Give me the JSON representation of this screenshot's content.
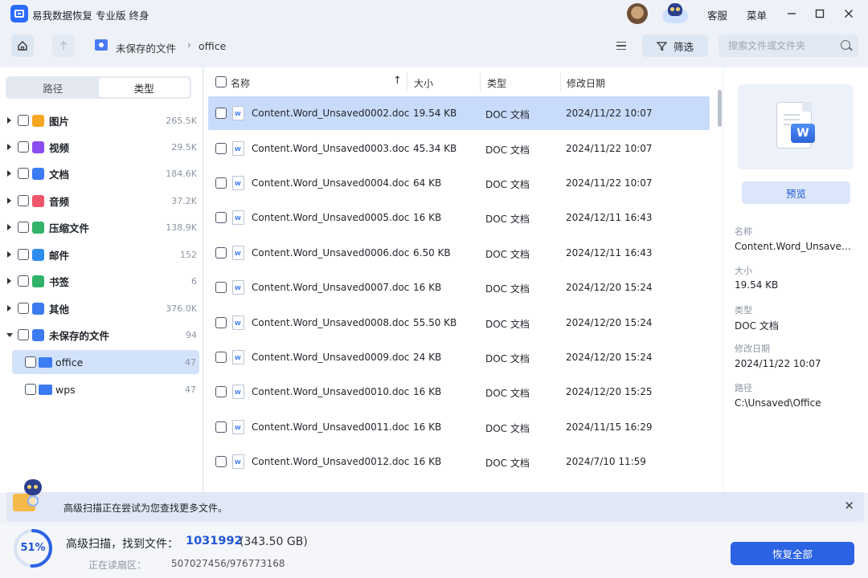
{
  "app": {
    "title": "易我数据恢复 专业版 终身",
    "service": "客服",
    "menu": "菜单"
  },
  "nav": {
    "crumbs": [
      "未保存的文件",
      "office"
    ],
    "crumb_sep": "›",
    "filter_label": "筛选",
    "search_placeholder": "搜索文件或文件夹"
  },
  "sidebar": {
    "tabs": [
      "路径",
      "类型"
    ],
    "active_tab": "类型",
    "categories": [
      {
        "label": "图片",
        "count": "265.5K",
        "icon": "image-icon",
        "color": "#f5a623"
      },
      {
        "label": "视频",
        "count": "29.5K",
        "icon": "video-icon",
        "color": "#8a4cf0"
      },
      {
        "label": "文档",
        "count": "184.6K",
        "icon": "document-icon",
        "color": "#3d7bf2"
      },
      {
        "label": "音频",
        "count": "37.2K",
        "icon": "audio-icon",
        "color": "#f0566a"
      },
      {
        "label": "压缩文件",
        "count": "138.9K",
        "icon": "archive-icon",
        "color": "#34b36b"
      },
      {
        "label": "邮件",
        "count": "152",
        "icon": "mail-icon",
        "color": "#2f8df0"
      },
      {
        "label": "书签",
        "count": "6",
        "icon": "bookmark-icon",
        "color": "#2fb36a"
      },
      {
        "label": "其他",
        "count": "376.0K",
        "icon": "other-icon",
        "color": "#3d7bf2"
      },
      {
        "label": "未保存的文件",
        "count": "94",
        "icon": "unsaved-folder-icon",
        "color": "#3d7bf2"
      }
    ],
    "children": [
      {
        "label": "office",
        "count": "47"
      },
      {
        "label": "wps",
        "count": "47"
      }
    ]
  },
  "table": {
    "headers": {
      "name": "名称",
      "size": "大小",
      "type": "类型",
      "modified": "修改日期"
    },
    "rows": [
      {
        "name": "Content.Word_Unsaved0002.doc",
        "size": "19.54 KB",
        "type": "DOC 文档",
        "modified": "2024/11/22 10:07"
      },
      {
        "name": "Content.Word_Unsaved0003.doc",
        "size": "45.34 KB",
        "type": "DOC 文档",
        "modified": "2024/11/22 10:07"
      },
      {
        "name": "Content.Word_Unsaved0004.doc",
        "size": "64 KB",
        "type": "DOC 文档",
        "modified": "2024/11/22 10:07"
      },
      {
        "name": "Content.Word_Unsaved0005.doc",
        "size": "16 KB",
        "type": "DOC 文档",
        "modified": "2024/12/11 16:43"
      },
      {
        "name": "Content.Word_Unsaved0006.doc",
        "size": "6.50 KB",
        "type": "DOC 文档",
        "modified": "2024/12/11 16:43"
      },
      {
        "name": "Content.Word_Unsaved0007.doc",
        "size": "16 KB",
        "type": "DOC 文档",
        "modified": "2024/12/20 15:24"
      },
      {
        "name": "Content.Word_Unsaved0008.doc",
        "size": "55.50 KB",
        "type": "DOC 文档",
        "modified": "2024/12/20 15:24"
      },
      {
        "name": "Content.Word_Unsaved0009.doc",
        "size": "24 KB",
        "type": "DOC 文档",
        "modified": "2024/12/20 15:24"
      },
      {
        "name": "Content.Word_Unsaved0010.doc",
        "size": "16 KB",
        "type": "DOC 文档",
        "modified": "2024/12/20 15:25"
      },
      {
        "name": "Content.Word_Unsaved0011.doc",
        "size": "16 KB",
        "type": "DOC 文档",
        "modified": "2024/11/15 16:29"
      },
      {
        "name": "Content.Word_Unsaved0012.doc",
        "size": "16 KB",
        "type": "DOC 文档",
        "modified": "2024/7/10 11:59"
      }
    ]
  },
  "details": {
    "preview_button": "预览",
    "name_label": "名称",
    "name_value": "Content.Word_Unsaved...",
    "size_label": "大小",
    "size_value": "19.54 KB",
    "type_label": "类型",
    "type_value": "DOC 文档",
    "modified_label": "修改日期",
    "modified_value": "2024/11/22 10:07",
    "path_label": "路径",
    "path_value": "C:\\Unsaved\\Office"
  },
  "notice": {
    "text": "高级扫描正在尝试为您查找更多文件。"
  },
  "status": {
    "progress_percent": 51,
    "progress_label": "51%",
    "title": "高级扫描，找到文件：",
    "count": "1031992",
    "size": "(343.50 GB)",
    "sub_label": "正在读扇区：",
    "sub_value": "507027456/976773168",
    "recover_button": "恢复全部"
  },
  "colors": {
    "accent": "#2c63e4",
    "selected_row": "#c9dbfb"
  }
}
